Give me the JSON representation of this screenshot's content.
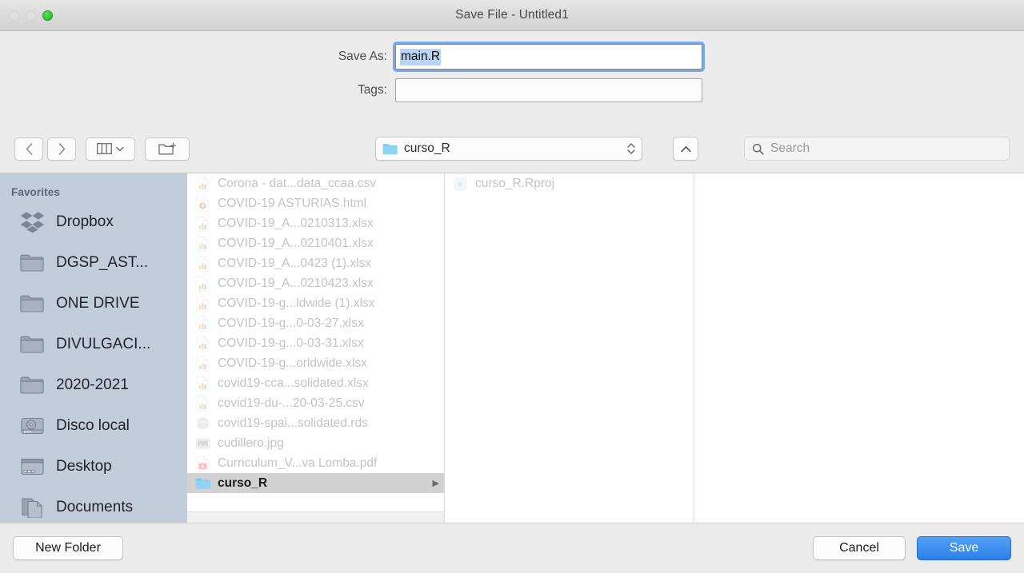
{
  "window": {
    "title": "Save File - Untitled1",
    "traffic_lights": [
      {
        "name": "close-button",
        "state": "disabled"
      },
      {
        "name": "minimize-button",
        "state": "disabled"
      },
      {
        "name": "zoom-button",
        "state": "enabled",
        "color": "#2ac32d"
      }
    ]
  },
  "form": {
    "save_as_label": "Save As:",
    "save_as_value": "main.R",
    "save_as_selected": true,
    "tags_label": "Tags:",
    "tags_value": "",
    "focus_ring_color": "#659ee9",
    "selection_color": "#b9d5f5"
  },
  "toolbar": {
    "back_icon": "chevron-left-icon",
    "forward_icon": "chevron-right-icon",
    "view_mode_icon": "column-view-icon",
    "view_mode_chevron": "chevron-down-icon",
    "new_folder_icon": "new-folder-icon",
    "path_name": "curso_R",
    "path_icon": "folder-icon",
    "stepper_icon": "up-down-chevrons-icon",
    "up_button_icon": "chevron-up-icon",
    "search_icon": "search-icon",
    "search_placeholder": "Search",
    "search_value": ""
  },
  "sidebar": {
    "section_title": "Favorites",
    "background": "#c2cdda",
    "items": [
      {
        "label": "Dropbox",
        "icon": "dropbox-icon"
      },
      {
        "label": "DGSP_AST...",
        "icon": "folder-icon"
      },
      {
        "label": "ONE DRIVE",
        "icon": "folder-icon"
      },
      {
        "label": "DIVULGACI...",
        "icon": "folder-icon"
      },
      {
        "label": "2020-2021",
        "icon": "folder-icon"
      },
      {
        "label": "Disco local",
        "icon": "hard-drive-icon"
      },
      {
        "label": "Desktop",
        "icon": "desktop-icon"
      },
      {
        "label": "Documents",
        "icon": "documents-icon"
      }
    ]
  },
  "browser": {
    "column_1": [
      {
        "name": "Corona - dat...data_ccaa.csv",
        "icon": "spreadsheet-icon",
        "selected": false,
        "enabled": false
      },
      {
        "name": "COVID-19 ASTURIAS.html",
        "icon": "html-icon",
        "selected": false,
        "enabled": false
      },
      {
        "name": "COVID-19_A...0210313.xlsx",
        "icon": "spreadsheet-icon",
        "selected": false,
        "enabled": false
      },
      {
        "name": "COVID-19_A...0210401.xlsx",
        "icon": "spreadsheet-icon",
        "selected": false,
        "enabled": false
      },
      {
        "name": "COVID-19_A...0423 (1).xlsx",
        "icon": "spreadsheet-icon",
        "selected": false,
        "enabled": false
      },
      {
        "name": "COVID-19_A...0210423.xlsx",
        "icon": "spreadsheet-icon",
        "selected": false,
        "enabled": false
      },
      {
        "name": "COVID-19-g...ldwide (1).xlsx",
        "icon": "spreadsheet-icon",
        "selected": false,
        "enabled": false
      },
      {
        "name": "COVID-19-g...0-03-27.xlsx",
        "icon": "spreadsheet-icon",
        "selected": false,
        "enabled": false
      },
      {
        "name": "COVID-19-g...0-03-31.xlsx",
        "icon": "spreadsheet-icon",
        "selected": false,
        "enabled": false
      },
      {
        "name": "COVID-19-g...orldwide.xlsx",
        "icon": "spreadsheet-icon",
        "selected": false,
        "enabled": false
      },
      {
        "name": "covid19-cca...solidated.xlsx",
        "icon": "spreadsheet-icon",
        "selected": false,
        "enabled": false
      },
      {
        "name": "covid19-du-...20-03-25.csv",
        "icon": "spreadsheet-icon",
        "selected": false,
        "enabled": false
      },
      {
        "name": "covid19-spai...solidated.rds",
        "icon": "rds-icon",
        "selected": false,
        "enabled": false
      },
      {
        "name": "cudillero.jpg",
        "icon": "image-icon",
        "selected": false,
        "enabled": false
      },
      {
        "name": "Curriculum_V...va Lomba.pdf",
        "icon": "pdf-icon",
        "selected": false,
        "enabled": false
      },
      {
        "name": "curso_R",
        "icon": "folder-icon",
        "selected": true,
        "enabled": true,
        "has_children": true
      }
    ],
    "column_2": [
      {
        "name": "curso_R.Rproj",
        "icon": "rproj-icon",
        "selected": false,
        "enabled": false
      }
    ],
    "column_3": []
  },
  "footer": {
    "new_folder_label": "New Folder",
    "cancel_label": "Cancel",
    "save_label": "Save",
    "save_accent": "#2b7fe8"
  }
}
